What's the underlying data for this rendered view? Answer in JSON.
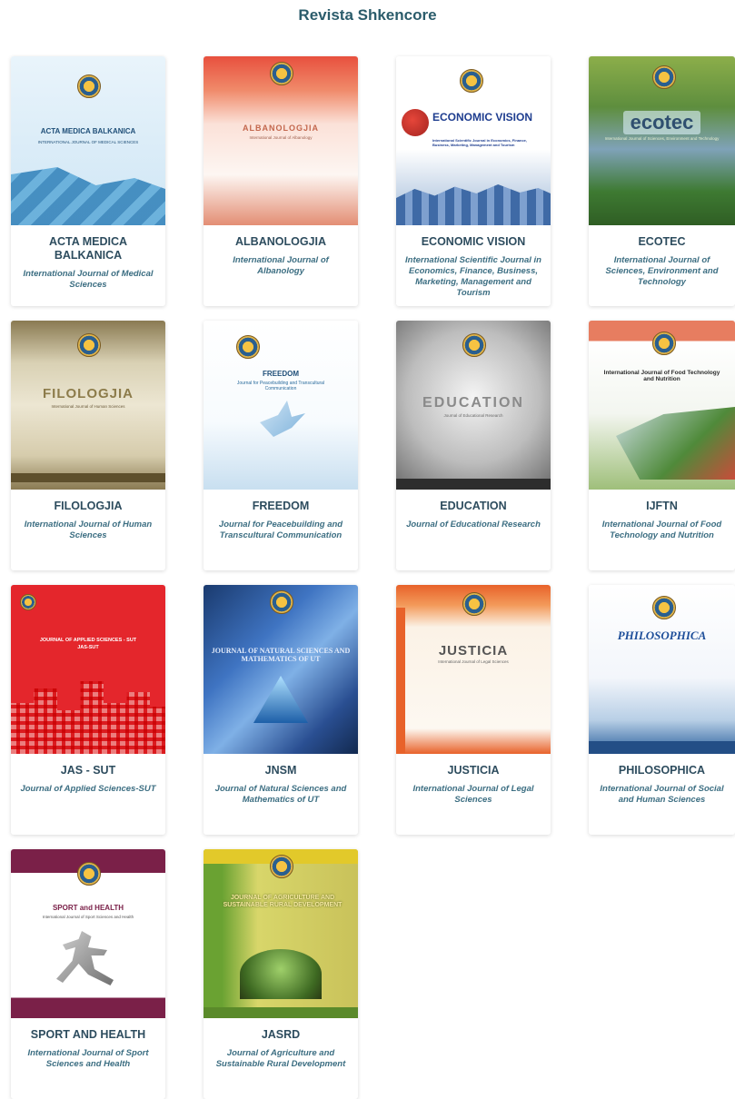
{
  "page": {
    "title": "Revista Shkencore"
  },
  "journals": [
    {
      "name": "ACTA MEDICA BALKANICA",
      "subtitle": "International Journal of Medical Sciences",
      "cover_title": "ACTA MEDICA BALKANICA",
      "cover_sub": "INTERNATIONAL JOURNAL OF MEDICAL SCIENCES"
    },
    {
      "name": "ALBANOLOGJIA",
      "subtitle": "International Journal of Albanology",
      "cover_title": "ALBANOLOGJIA",
      "cover_sub": "International Journal of Albanology"
    },
    {
      "name": "ECONOMIC VISION",
      "subtitle": "International Scientific Journal in Economics, Finance, Business, Marketing, Management and Tourism",
      "cover_title": "ECONOMIC VISION",
      "cover_sub": "International Scientific Journal in Economics, Finance, Business, Marketing, Management and Tourism"
    },
    {
      "name": "ECOTEC",
      "subtitle": "International Journal of Sciences, Environment and Technology",
      "cover_title": "ecotec",
      "cover_sub": "International Journal of Sciences, Environment and Technology"
    },
    {
      "name": "FILOLOGJIA",
      "subtitle": "International Journal of Human Sciences",
      "cover_title": "FILOLOGJIA",
      "cover_sub": "International Journal of Human Sciences"
    },
    {
      "name": "FREEDOM",
      "subtitle": "Journal for Peacebuilding and Transcultural Communication",
      "cover_title": "FREEDOM",
      "cover_sub": "Journal for Peacebuilding and Transcultural Communication"
    },
    {
      "name": "EDUCATION",
      "subtitle": "Journal of Educational Research",
      "cover_title": "EDUCATION",
      "cover_sub": "Journal of Educational Research"
    },
    {
      "name": "IJFTN",
      "subtitle": "International Journal of Food Technology and Nutrition",
      "cover_title": "International Journal of Food Technology and Nutrition",
      "cover_sub": ""
    },
    {
      "name": "JAS - SUT",
      "subtitle": "Journal of Applied Sciences-SUT",
      "cover_title": "JOURNAL OF APPLIED SCIENCES - SUT",
      "cover_sub": "JAS-SUT"
    },
    {
      "name": "JNSM",
      "subtitle": "Journal of Natural Sciences and Mathematics of UT",
      "cover_title": "JOURNAL OF NATURAL SCIENCES AND MATHEMATICS OF UT",
      "cover_sub": ""
    },
    {
      "name": "JUSTICIA",
      "subtitle": "International Journal of Legal Sciences",
      "cover_title": "JUSTICIA",
      "cover_sub": "International Journal of Legal Sciences"
    },
    {
      "name": "PHILOSOPHICA",
      "subtitle": "International Journal of Social and Human Sciences",
      "cover_title": "PHILOSOPHICA",
      "cover_sub": ""
    },
    {
      "name": "SPORT AND HEALTH",
      "subtitle": "International Journal of Sport Sciences and Health",
      "cover_title": "SPORT and HEALTH",
      "cover_sub": "International Journal of Sport Sciences and Health"
    },
    {
      "name": "JASRD",
      "subtitle": "Journal of Agriculture and Sustainable Rural Development",
      "cover_title": "JOURNAL OF AGRICULTURE AND SUSTAINABLE RURAL DEVELOPMENT",
      "cover_sub": ""
    }
  ]
}
